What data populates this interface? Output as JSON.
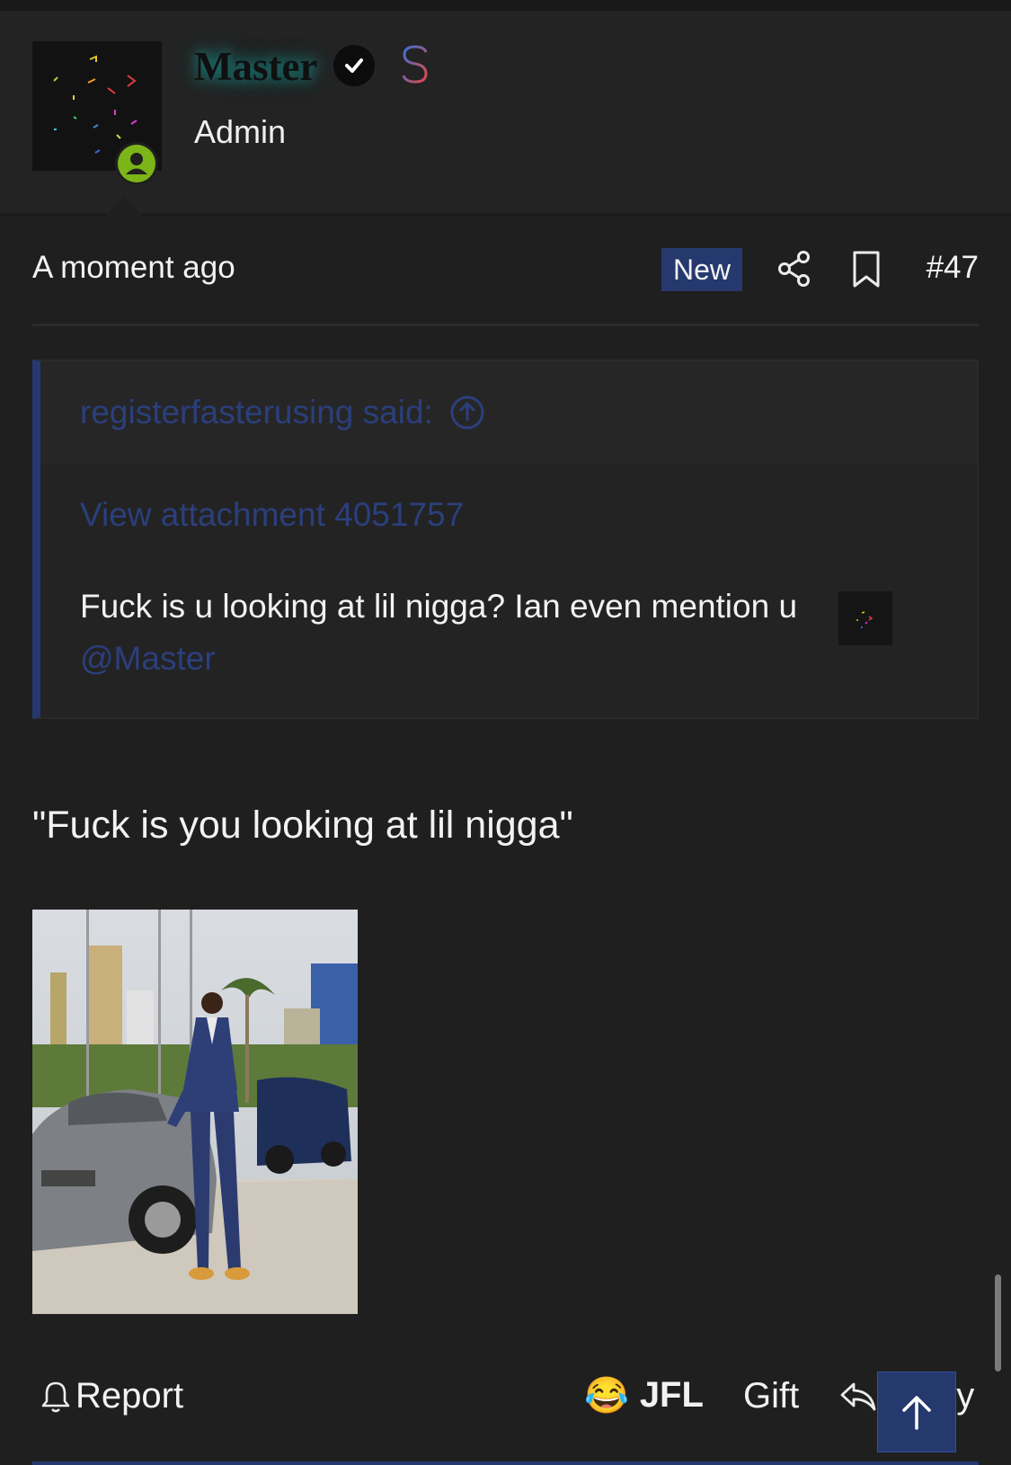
{
  "user": {
    "name": "Master",
    "title": "Admin",
    "badge_icon": "verified-check-icon",
    "currency_icon": "dollar-icon",
    "online_icon": "online-user-icon"
  },
  "post_meta": {
    "time": "A moment ago",
    "new_label": "New",
    "post_number": "#47"
  },
  "quote": {
    "author": "registerfasterusing said:",
    "attachment_link": "View attachment 4051757",
    "text": "Fuck is u looking at lil nigga? Ian even mention u",
    "mention": "@Master"
  },
  "post": {
    "text": "\"Fuck is you looking at lil nigga\""
  },
  "actions": {
    "report": "Report",
    "reaction": "JFL",
    "reaction_emoji": "😂",
    "gift": "Gift",
    "reply": "Reply"
  },
  "colors": {
    "background": "#1f1f1f",
    "accent": "#25396f",
    "link": "#2b3f7d",
    "online": "#7cb518"
  }
}
